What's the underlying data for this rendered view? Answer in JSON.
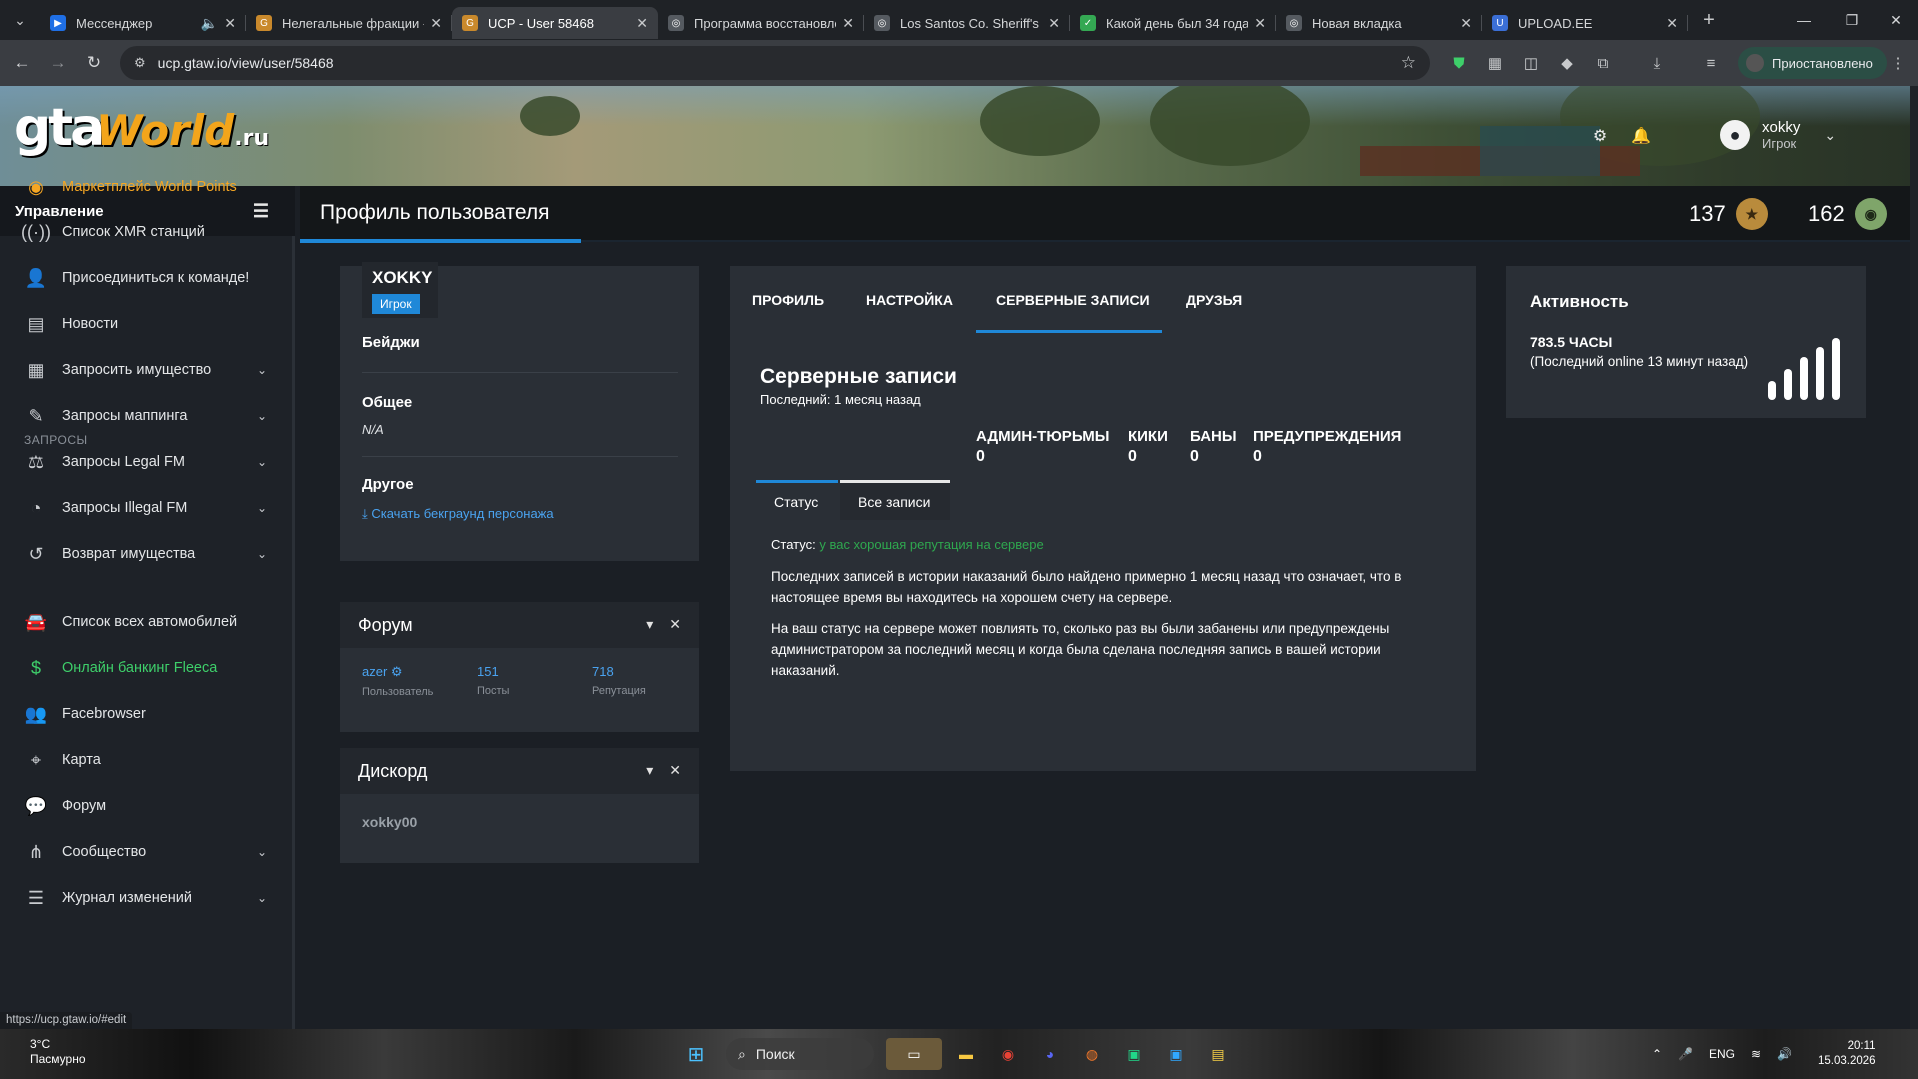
{
  "browser": {
    "tabs": [
      {
        "title": "Мессенджер",
        "favicon_color": "#1f6fe5",
        "favicon_glyph": "▶",
        "audio": true
      },
      {
        "title": "Нелегальные фракции -",
        "favicon_color": "#c9892c",
        "favicon_glyph": "G"
      },
      {
        "title": "UCP - User 58468",
        "favicon_color": "#c9892c",
        "favicon_glyph": "G",
        "active": true
      },
      {
        "title": "Программа восстановле",
        "favicon_color": "#555a60",
        "favicon_glyph": "◎"
      },
      {
        "title": "Los Santos Co. Sheriff's D",
        "favicon_color": "#555a60",
        "favicon_glyph": "◎"
      },
      {
        "title": "Какой день был 34 года",
        "favicon_color": "#34a853",
        "favicon_glyph": "✓"
      },
      {
        "title": "Новая вкладка",
        "favicon_color": "#555a60",
        "favicon_glyph": "◎"
      },
      {
        "title": "UPLOAD.EE",
        "favicon_color": "#3b6fd6",
        "favicon_glyph": "U"
      }
    ],
    "url": "ucp.gtaw.io/view/user/58468",
    "profile_status": "Приостановлено"
  },
  "header": {
    "logo_gta": "gta",
    "logo_world": "World",
    "logo_ru": ".ru",
    "user_name": "xokky",
    "user_role": "Игрок"
  },
  "sidebar": {
    "title": "Управление",
    "items": [
      {
        "label": "Маркетплейс World Points",
        "icon": "coins-icon",
        "glyph": "◉",
        "style": "orange"
      },
      {
        "label": "Список XMR станций",
        "icon": "antenna-icon",
        "glyph": "((·))"
      },
      {
        "label": "Присоединиться к команде!",
        "icon": "user-plus-icon",
        "glyph": "👤"
      },
      {
        "label": "Новости",
        "icon": "newspaper-icon",
        "glyph": "▤"
      },
      {
        "label": "Запросить имущество",
        "icon": "building-icon",
        "glyph": "▦",
        "caret": true
      },
      {
        "label": "Запросы маппинга",
        "icon": "brush-icon",
        "glyph": "✎",
        "caret": true
      },
      {
        "label": "Запросы Legal FM",
        "icon": "scales-icon",
        "glyph": "⚖",
        "caret": true
      },
      {
        "label": "Запросы Illegal FM",
        "icon": "mask-icon",
        "glyph": "◔",
        "caret": true
      },
      {
        "label": "Возврат имущества",
        "icon": "undo-icon",
        "glyph": "↺",
        "caret": true
      },
      {
        "label": "Список всех автомобилей",
        "icon": "car-icon",
        "glyph": "🚘"
      },
      {
        "label": "Онлайн банкинг Fleeca",
        "icon": "money-icon",
        "glyph": "$",
        "style": "green"
      },
      {
        "label": "Facebrowser",
        "icon": "users-icon",
        "glyph": "👥"
      },
      {
        "label": "Карта",
        "icon": "map-icon",
        "glyph": "⌖"
      },
      {
        "label": "Форум",
        "icon": "comments-icon",
        "glyph": "💬"
      },
      {
        "label": "Сообщество",
        "icon": "share-icon",
        "glyph": "⋔",
        "caret": true
      },
      {
        "label": "Журнал изменений",
        "icon": "list-icon",
        "glyph": "☰",
        "caret": true
      }
    ],
    "group_label": "Запросы",
    "status_url": "https://ucp.gtaw.io/#edit"
  },
  "content": {
    "page_title": "Профиль пользователя",
    "stat1": "137",
    "stat2": "162"
  },
  "profile": {
    "name": "XOKKY",
    "role": "Игрок",
    "badges_label": "Бейджи",
    "general_label": "Общее",
    "general_value": "N/A",
    "other_label": "Другое",
    "download_link": "Скачать бекграунд персонажа"
  },
  "forum": {
    "title": "Форум",
    "user_value": "azer",
    "user_label": "Пользователь",
    "posts_value": "151",
    "posts_label": "Посты",
    "rep_value": "718",
    "rep_label": "Репутация"
  },
  "discord": {
    "title": "Дискорд",
    "name": "xokky00"
  },
  "records": {
    "tabs": [
      "ПРОФИЛЬ",
      "НАСТРОЙКА",
      "СЕРВЕРНЫЕ ЗАПИСИ",
      "ДРУЗЬЯ"
    ],
    "title": "Серверные записи",
    "last": "Последний: 1 месяц назад",
    "stats": [
      {
        "label": "АДМИН-ТЮРЬМЫ",
        "value": "0"
      },
      {
        "label": "КИКИ",
        "value": "0"
      },
      {
        "label": "БАНЫ",
        "value": "0"
      },
      {
        "label": "ПРЕДУПРЕЖДЕНИЯ",
        "value": "0"
      }
    ],
    "subtabs": [
      "Статус",
      "Все записи"
    ],
    "status_label": "Статус:",
    "status_value": "у вас хорошая репутация на сервере",
    "para1": "Последних записей в истории наказаний было найдено примерно 1 месяц назад что означает, что в настоящее время вы находитесь на хорошем счету на сервере.",
    "para2": "На ваш статус на сервере может повлиять то, сколько раз вы были забанены или предупреждены администратором за последний месяц и когда была сделана последняя запись в вашей истории наказаний."
  },
  "activity": {
    "title": "Активность",
    "hours": "783.5 ЧАСЫ",
    "last_online": "(Последний online 13 минут назад)",
    "signal_bars": [
      0.3,
      0.5,
      0.7,
      0.85,
      1.0
    ]
  },
  "taskbar": {
    "weather_temp": "3°C",
    "weather_desc": "Пасмурно",
    "search": "Поиск",
    "lang": "ENG",
    "time": "20:11",
    "date": "15.03.2026"
  }
}
